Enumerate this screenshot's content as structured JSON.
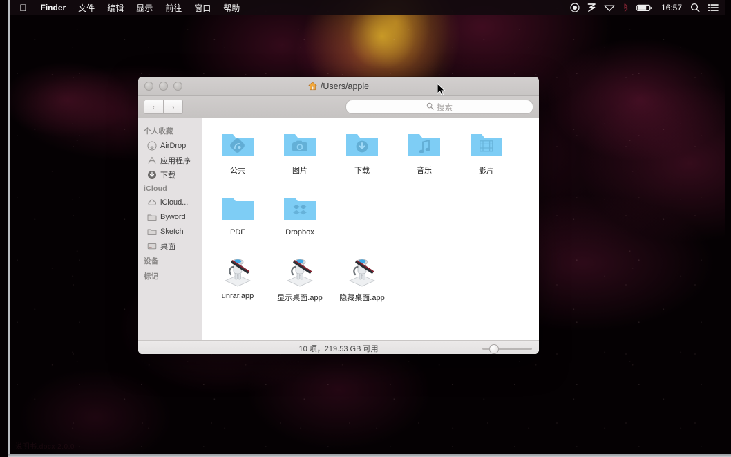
{
  "menubar": {
    "apple_logo": "apple-logo",
    "items": [
      {
        "label": "Finder",
        "bold": true
      },
      {
        "label": "文件",
        "bold": false
      },
      {
        "label": "编辑",
        "bold": false
      },
      {
        "label": "显示",
        "bold": false
      },
      {
        "label": "前往",
        "bold": false
      },
      {
        "label": "窗口",
        "bold": false
      },
      {
        "label": "帮助",
        "bold": false
      }
    ],
    "status": {
      "record_icon": "record-circle-icon",
      "input_method_icon": "sogou-input-icon",
      "wifi_icon": "wifi-icon",
      "bluetooth_icon": "bluetooth-icon",
      "battery_icon": "battery-icon",
      "clock": "16:57",
      "search_icon": "spotlight-search-icon",
      "notification_icon": "notification-center-icon"
    }
  },
  "window": {
    "title": "/Users/apple",
    "title_icon": "home-icon",
    "traffic_lights": [
      "close-button",
      "minimize-button",
      "zoom-button"
    ],
    "toolbar": {
      "back_label": "‹",
      "forward_label": "›",
      "search_placeholder": "搜索",
      "search_value": ""
    },
    "sidebar": {
      "sections": [
        {
          "header": "个人收藏",
          "items": [
            {
              "label": "AirDrop",
              "icon": "airdrop-icon"
            },
            {
              "label": "应用程序",
              "icon": "applications-icon"
            },
            {
              "label": "下载",
              "icon": "downloads-icon"
            }
          ]
        },
        {
          "header": "iCloud",
          "items": [
            {
              "label": "iCloud...",
              "icon": "icloud-icon"
            },
            {
              "label": "Byword",
              "icon": "folder-icon"
            },
            {
              "label": "Sketch",
              "icon": "folder-icon"
            },
            {
              "label": "桌面",
              "icon": "desktop-icon"
            }
          ]
        },
        {
          "header": "设备",
          "items": []
        },
        {
          "header": "标记",
          "items": []
        }
      ]
    },
    "items": [
      {
        "label": "公共",
        "icon": "folder-public-icon",
        "kind": "folder"
      },
      {
        "label": "图片",
        "icon": "folder-pictures-icon",
        "kind": "folder"
      },
      {
        "label": "下载",
        "icon": "folder-downloads-icon",
        "kind": "folder"
      },
      {
        "label": "音乐",
        "icon": "folder-music-icon",
        "kind": "folder"
      },
      {
        "label": "影片",
        "icon": "folder-movies-icon",
        "kind": "folder"
      },
      {
        "label": "PDF",
        "icon": "folder-plain-icon",
        "kind": "folder"
      },
      {
        "label": "Dropbox",
        "icon": "folder-dropbox-icon",
        "kind": "folder"
      },
      {
        "label": "unrar.app",
        "icon": "automator-robot-icon",
        "kind": "app"
      },
      {
        "label": "显示桌面.app",
        "icon": "automator-robot-icon",
        "kind": "app"
      },
      {
        "label": "隐藏桌面.app",
        "icon": "automator-robot-icon",
        "kind": "app"
      }
    ],
    "statusbar": {
      "text": "10 项，219.53 GB 可用",
      "zoom_slider": "icon-size-slider"
    }
  },
  "desktop": {
    "faint_label": "说明书.docx 2.0.0",
    "cursor": "arrow-cursor"
  },
  "colors": {
    "folder_blue": "#7ecdf5",
    "menubar_bg": "#120a0e",
    "window_chrome": "#cdcac9",
    "sidebar_bg": "#e2dfe0",
    "wallpaper_crimson": "#6e1638",
    "wallpaper_gold": "#d6a828"
  }
}
